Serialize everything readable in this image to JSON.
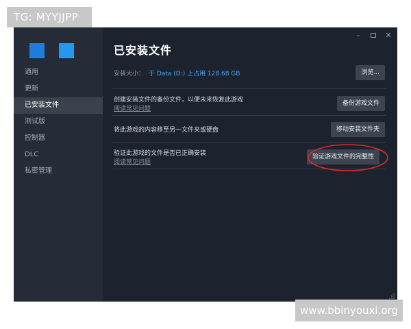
{
  "watermarks": {
    "top_left": "TG: MYYJJPP",
    "bottom_right": "www.bbinyouxi.org"
  },
  "window_controls": [
    "minimize-icon",
    "maximize-icon",
    "close-icon"
  ],
  "sidebar": {
    "logo_icons": [
      "blue-square-icon",
      "blue-square-icon"
    ],
    "items": [
      {
        "label": "通用",
        "active": false
      },
      {
        "label": "更新",
        "active": false
      },
      {
        "label": "已安装文件",
        "active": true
      },
      {
        "label": "测试版",
        "active": false
      },
      {
        "label": "控制器",
        "active": false
      },
      {
        "label": "DLC",
        "active": false
      },
      {
        "label": "私密管理",
        "active": false
      }
    ]
  },
  "main": {
    "title": "已安装文件",
    "install_size_label": "安装大小：",
    "install_size_value": "于 Data (D:) 上占用 128.68 GB",
    "browse_button": "浏览...",
    "rows": [
      {
        "text": "创建安装文件的备份文件，以便未来恢复此游戏",
        "link": "阅读常见问题",
        "button": "备份游戏文件"
      },
      {
        "text": "将此游戏的内容移至另一文件夹或硬盘",
        "button": "移动安装文件夹"
      },
      {
        "text": "验证此游戏的文件是否已正确安装",
        "link": "阅读常见问题",
        "button": "验证游戏文件的完整性"
      }
    ]
  },
  "colors": {
    "window_bg": "#1c232f",
    "sidebar_bg": "#262c37",
    "active_item_bg": "#3b424d",
    "accent_blue": "#4da3ff",
    "button_bg": "#3d4450",
    "highlight_ring": "#d62b2b",
    "watermark_bg": "#c8c8c8"
  }
}
